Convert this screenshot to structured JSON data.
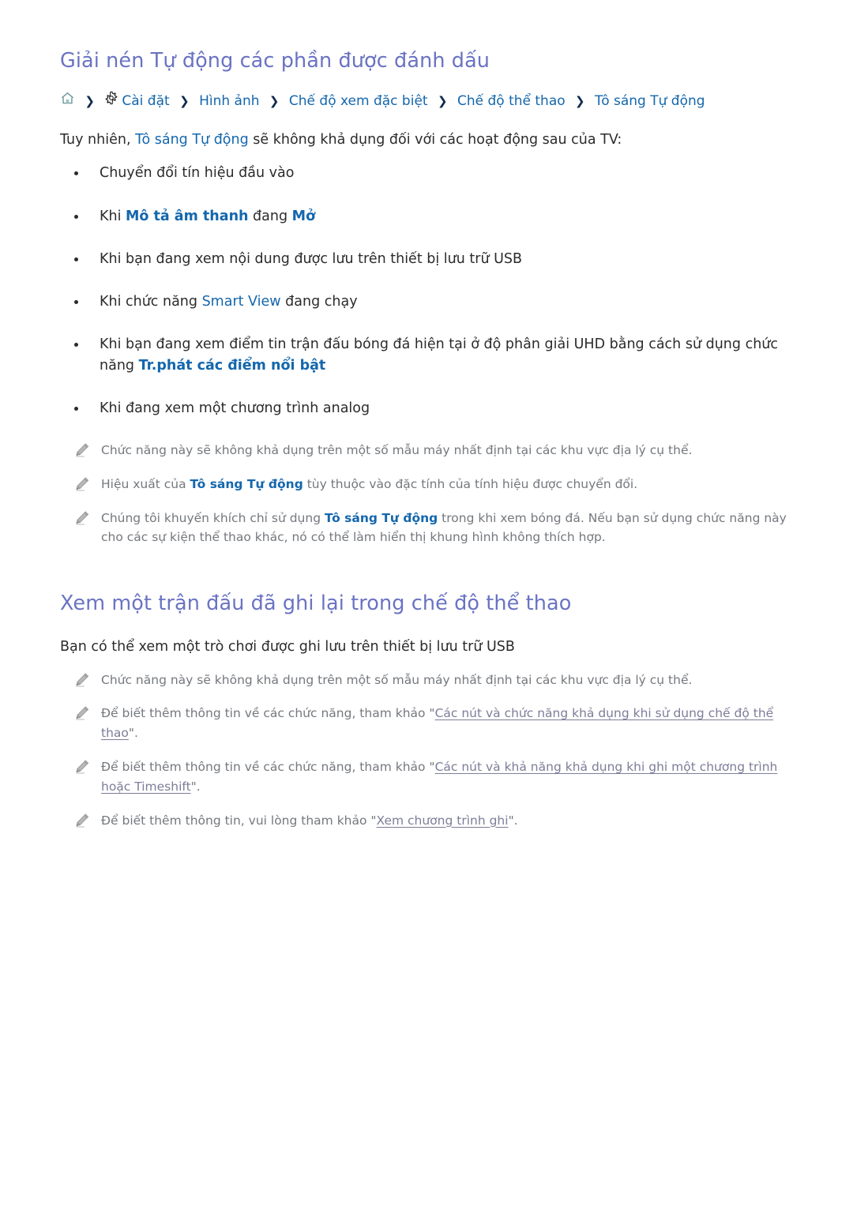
{
  "colors": {
    "heading": "#6a73c2",
    "link_blue": "#1467ad",
    "body_text": "#2b2b2b",
    "note_text": "#74787d",
    "note_link": "#7d7d99",
    "home_icon": "#6f9a9a",
    "background": "#ffffff"
  },
  "section1": {
    "title": "Giải nén Tự động các phần được đánh dấu",
    "breadcrumb": {
      "home_icon": "home-icon",
      "gear_icon": "gear-icon",
      "separator": "❯",
      "items": [
        "Cài đặt",
        "Hình ảnh",
        "Chế độ xem đặc biệt",
        "Chế độ thể thao",
        "Tô sáng Tự động"
      ]
    },
    "intro": {
      "before": "Tuy nhiên, ",
      "link": "Tô sáng Tự động",
      "after": " sẽ không khả dụng đối với các hoạt động sau của TV:"
    },
    "bullets": [
      {
        "parts": [
          {
            "text": "Chuyển đổi tín hiệu đầu vào",
            "style": "plain"
          }
        ]
      },
      {
        "parts": [
          {
            "text": "Khi ",
            "style": "plain"
          },
          {
            "text": "Mô tả âm thanh",
            "style": "link-bold"
          },
          {
            "text": " đang ",
            "style": "plain"
          },
          {
            "text": "Mở",
            "style": "link-bold"
          }
        ]
      },
      {
        "parts": [
          {
            "text": "Khi bạn đang xem nội dung được lưu trên thiết bị lưu trữ USB",
            "style": "plain"
          }
        ]
      },
      {
        "parts": [
          {
            "text": "Khi chức năng ",
            "style": "plain"
          },
          {
            "text": "Smart View",
            "style": "link"
          },
          {
            "text": " đang chạy",
            "style": "plain"
          }
        ]
      },
      {
        "parts": [
          {
            "text": "Khi bạn đang xem điểm tin trận đấu bóng đá hiện tại ở độ phân giải UHD bằng cách sử dụng chức năng ",
            "style": "plain"
          },
          {
            "text": "Tr.phát các điểm nổi bật",
            "style": "link-bold"
          }
        ]
      },
      {
        "parts": [
          {
            "text": " Khi đang xem một chương trình analog",
            "style": "plain"
          }
        ]
      }
    ],
    "notes": [
      {
        "parts": [
          {
            "text": "Chức năng này sẽ không khả dụng trên một số mẫu máy nhất định tại các khu vực địa lý cụ thể.",
            "style": "plain"
          }
        ]
      },
      {
        "parts": [
          {
            "text": "Hiệu xuất của ",
            "style": "plain"
          },
          {
            "text": "Tô sáng Tự động",
            "style": "link-bold"
          },
          {
            "text": " tùy thuộc vào đặc tính của tính hiệu được chuyển đổi.",
            "style": "plain"
          }
        ]
      },
      {
        "parts": [
          {
            "text": "Chúng tôi khuyến khích chỉ sử dụng ",
            "style": "plain"
          },
          {
            "text": "Tô sáng Tự động",
            "style": "link-bold"
          },
          {
            "text": " trong khi xem bóng đá. Nếu bạn sử dụng chức năng này cho các sự kiện thể thao khác, nó có thể làm hiển thị khung hình không thích hợp.",
            "style": "plain"
          }
        ]
      }
    ]
  },
  "section2": {
    "title": "Xem một trận đấu đã ghi lại trong chế độ thể thao",
    "intro": "Bạn có thể xem một trò chơi được ghi lưu trên thiết bị lưu trữ USB",
    "notes": [
      {
        "parts": [
          {
            "text": "Chức năng này sẽ không khả dụng trên một số mẫu máy nhất định tại các khu vực địa lý cụ thể.",
            "style": "plain"
          }
        ]
      },
      {
        "parts": [
          {
            "text": "Để biết thêm thông tin về các chức năng, tham khảo \"",
            "style": "plain"
          },
          {
            "text": "Các nút và chức năng khả dụng khi sử dụng chế độ thể thao",
            "style": "underline-link"
          },
          {
            "text": "\".",
            "style": "plain"
          }
        ]
      },
      {
        "parts": [
          {
            "text": "Để biết thêm thông tin về các chức năng, tham khảo \"",
            "style": "plain"
          },
          {
            "text": "Các nút và khả năng khả dụng khi ghi một chương trình hoặc Timeshift",
            "style": "underline-link"
          },
          {
            "text": "\".",
            "style": "plain"
          }
        ]
      },
      {
        "parts": [
          {
            "text": "Để biết thêm thông tin, vui lòng tham khảo \"",
            "style": "plain"
          },
          {
            "text": "Xem chương trình ghi",
            "style": "underline-link"
          },
          {
            "text": "\".",
            "style": "plain"
          }
        ]
      }
    ]
  }
}
